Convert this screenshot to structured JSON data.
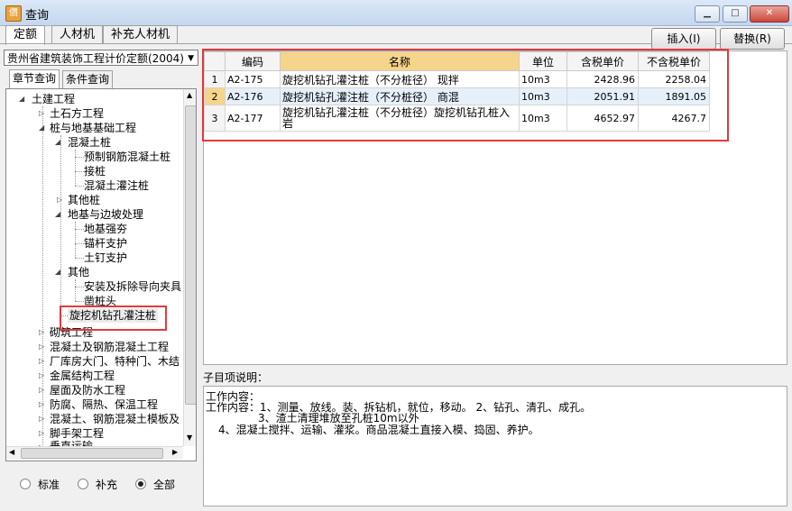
{
  "window": {
    "title": "查询",
    "app_icon": "app-icon",
    "min_icon": "minimize-icon",
    "max_icon": "maximize-icon",
    "close_icon": "close-icon"
  },
  "top_tabs": [
    "定额",
    "人材机",
    "补充人材机"
  ],
  "buttons": {
    "insert": "插入(I)",
    "replace": "替换(R)"
  },
  "left": {
    "dropdown_value": "贵州省建筑装饰工程计价定额(2004)",
    "sub_tabs": [
      "章节查询",
      "条件查询"
    ],
    "tree": [
      "土建工程",
      "土石方工程",
      "桩与地基基础工程",
      "混凝土桩",
      "预制钢筋混凝土桩",
      "接桩",
      "混凝土灌注桩",
      "其他桩",
      "地基与边坡处理",
      "地基强夯",
      "锚杆支护",
      "土钉支护",
      "其他",
      "安装及拆除导向夹具",
      "凿桩头",
      "旋挖机钻孔灌注桩",
      "砌筑工程",
      "混凝土及钢筋混凝土工程",
      "厂库房大门、特种门、木结",
      "金属结构工程",
      "屋面及防水工程",
      "防腐、隔热、保温工程",
      "混凝土、钢筋混凝土模板及",
      "脚手架工程",
      "垂直运输"
    ],
    "radios": [
      "标准",
      "补充",
      "全部"
    ],
    "radio_selected": "全部"
  },
  "table": {
    "headers": [
      "编码",
      "名称",
      "单位",
      "含税单价",
      "不含税单价"
    ],
    "rows": [
      {
        "no": "1",
        "code": "A2-175",
        "name": "旋挖机钻孔灌注桩（不分桩径） 现拌",
        "unit": "10m3",
        "price_tax": "2428.96",
        "price_notax": "2258.04"
      },
      {
        "no": "2",
        "code": "A2-176",
        "name": "旋挖机钻孔灌注桩（不分桩径） 商混",
        "unit": "10m3",
        "price_tax": "2051.91",
        "price_notax": "1891.05"
      },
      {
        "no": "3",
        "code": "A2-177",
        "name": "旋挖机钻孔灌注桩（不分桩径）旋挖机钻孔桩入岩",
        "unit": "10m3",
        "price_tax": "4652.97",
        "price_notax": "4267.7"
      }
    ]
  },
  "description": {
    "label": "子目项说明：",
    "lines": [
      "工作内容：",
      "工作内容：1、测量、放线。装、拆钻机，就位，移动。 2、钻孔、清孔、成孔。",
      "3、渣土清理堆放至孔桩10m以外",
      "4、混凝土搅拌、运输、灌浆。商品混凝土直接入模、捣固、养护。"
    ]
  },
  "colors": {
    "highlight": "#e23a3a",
    "header_selected": "#f5d58b"
  }
}
